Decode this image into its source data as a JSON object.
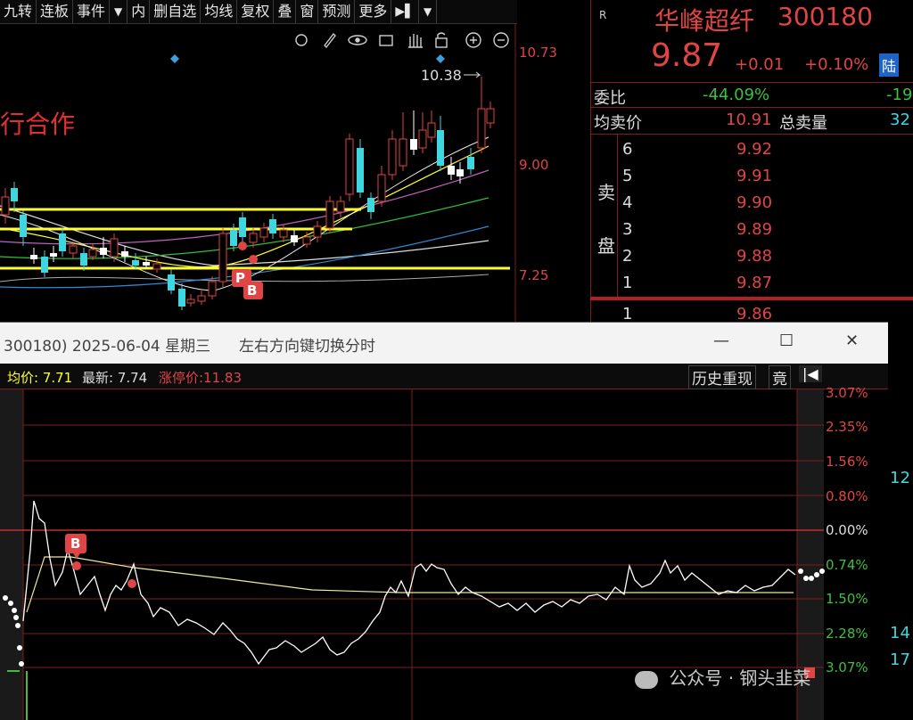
{
  "toolbar": {
    "items": [
      "九转",
      "连板",
      "事件",
      "▼",
      "内",
      "删自选",
      "均线",
      "复权",
      "叠",
      "窗",
      "预测",
      "更多"
    ]
  },
  "kline": {
    "axis_labels": [
      "10.73",
      "9.00",
      "7.25"
    ],
    "peak_label": "10.38",
    "headline": "行合作",
    "markers": [
      "P",
      "B"
    ]
  },
  "stock": {
    "r_badge": "R",
    "name": "华峰超纤",
    "code": "300180",
    "price": "9.87",
    "change": "+0.01",
    "change_pct": "+0.10%",
    "tag": "陆",
    "weibi_label": "委比",
    "weibi_value": "-44.09%",
    "weibi_right": "-19",
    "avg_ask_label": "均卖价",
    "avg_ask_value": "10.91",
    "total_ask_label": "总卖量",
    "total_ask_value": "32",
    "ask_side_label_1": "卖",
    "ask_side_label_2": "盘",
    "asks": [
      {
        "level": "6",
        "price": "9.92"
      },
      {
        "level": "5",
        "price": "9.91"
      },
      {
        "level": "4",
        "price": "9.90"
      },
      {
        "level": "3",
        "price": "9.89"
      },
      {
        "level": "2",
        "price": "9.88"
      },
      {
        "level": "1",
        "price": "9.87"
      }
    ],
    "bid1_level": "1",
    "bid1_price": "9.86",
    "side_numbers": [
      "12",
      "14",
      "17"
    ]
  },
  "popup": {
    "title": "300180) 2025-06-04 星期三",
    "hint": "左右方向键切换分时",
    "avg_label": "均价: 7.71",
    "latest_label": "最新: 7.74",
    "limit_label": "涨停价:11.83",
    "history_btn": "历史重现",
    "jing_btn": "竟",
    "marker": "B",
    "pct_labels": [
      "3.07%",
      "2.35%",
      "1.56%",
      "0.80%",
      "0.00%",
      "0.74%",
      "1.50%",
      "2.28%",
      "3.07%"
    ]
  },
  "watermark": "公众号 · 钢头韭菜",
  "colors": {
    "up": "#e04545",
    "down": "#3fd6e0",
    "neutral": "#ffffff",
    "yellow": "#ffff33",
    "green": "#3fbf3f",
    "grid_red": "#7a1f1f"
  }
}
